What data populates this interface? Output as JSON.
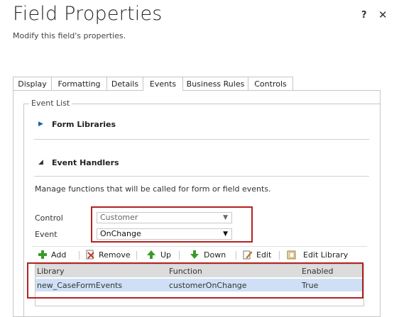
{
  "dialog": {
    "title": "Field Properties",
    "subtitle": "Modify this field's properties.",
    "help_label": "?",
    "close_label": "✕"
  },
  "tabs": [
    {
      "label": "Display"
    },
    {
      "label": "Formatting"
    },
    {
      "label": "Details"
    },
    {
      "label": "Events"
    },
    {
      "label": "Business Rules"
    },
    {
      "label": "Controls"
    }
  ],
  "active_tab": "Events",
  "event_list": {
    "legend": "Event List",
    "form_libraries": {
      "label": "Form Libraries",
      "arrow": "▶"
    },
    "event_handlers": {
      "label": "Event Handlers",
      "arrow": "◢"
    },
    "description": "Manage functions that will be called for form or field events.",
    "control": {
      "label": "Control",
      "value": "Customer"
    },
    "event": {
      "label": "Event",
      "value": "OnChange"
    }
  },
  "toolbar": {
    "add": "Add",
    "remove": "Remove",
    "up": "Up",
    "down": "Down",
    "edit": "Edit",
    "edit_library": "Edit Library"
  },
  "handlers_table": {
    "columns": [
      "Library",
      "Function",
      "Enabled"
    ],
    "rows": [
      {
        "library": "new_CaseFormEvents",
        "function": "customerOnChange",
        "enabled": "True"
      }
    ]
  },
  "colors": {
    "highlight_border": "#b22222",
    "selected_row": "#cfe0f6",
    "header_row": "#dcdcdc",
    "add_icon": "#3a9a2a",
    "remove_icon": "#c0392b"
  }
}
